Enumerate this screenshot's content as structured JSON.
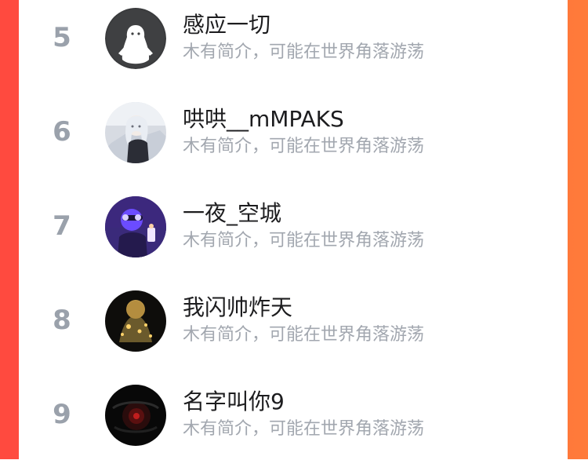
{
  "theme": {
    "background_gradient": [
      "#ff4a3f",
      "#ff7b3a"
    ],
    "card": "#ffffff",
    "rank_color": "#9aa1ab",
    "name_color": "#1d1d1f",
    "bio_color": "#a2a7af"
  },
  "ranking": {
    "items": [
      {
        "rank": "5",
        "name": "感应一切",
        "bio": "木有简介，可能在世界角落游荡",
        "avatar_icon": "default-user-avatar-icon"
      },
      {
        "rank": "6",
        "name": "哄哄__mMPAKS",
        "bio": "木有简介，可能在世界角落游荡",
        "avatar_icon": "anime-girl-avatar"
      },
      {
        "rank": "7",
        "name": "一夜_空城",
        "bio": "木有简介，可能在世界角落游荡",
        "avatar_icon": "purple-neon-avatar"
      },
      {
        "rank": "8",
        "name": "我闪帅炸天",
        "bio": "木有简介，可能在世界角落游荡",
        "avatar_icon": "golden-armor-avatar"
      },
      {
        "rank": "9",
        "name": "名字叫你9",
        "bio": "木有简介，可能在世界角落游荡",
        "avatar_icon": "dark-red-avatar"
      }
    ]
  }
}
